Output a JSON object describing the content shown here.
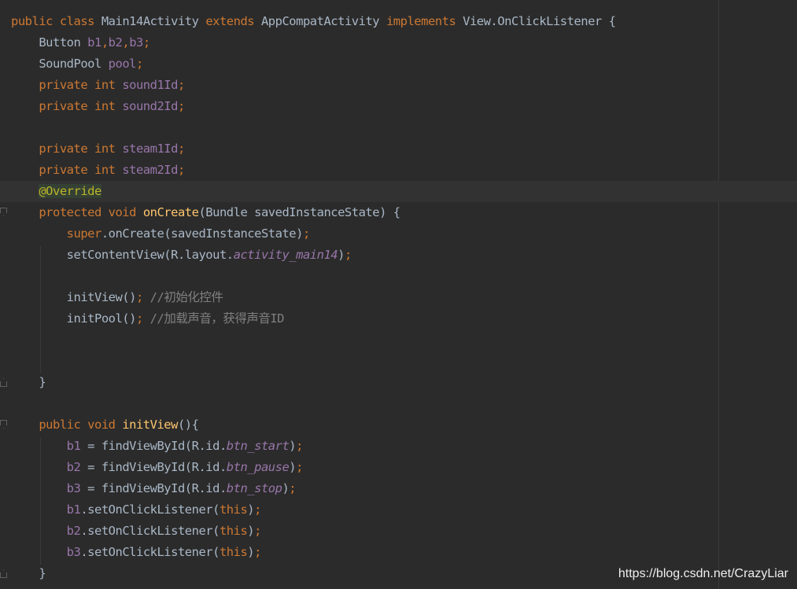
{
  "editor": {
    "highlighted_line": 9,
    "lines": [
      [
        [
          "keyword",
          "public class "
        ],
        [
          "plain",
          "Main14Activity "
        ],
        [
          "keyword",
          "extends "
        ],
        [
          "plain",
          "AppCompatActivity "
        ],
        [
          "keyword",
          "implements "
        ],
        [
          "plain",
          "View.OnClickListener {"
        ]
      ],
      [
        [
          "plain",
          "    Button "
        ],
        [
          "field",
          "b1"
        ],
        [
          "punct",
          ","
        ],
        [
          "field",
          "b2"
        ],
        [
          "punct",
          ","
        ],
        [
          "field",
          "b3"
        ],
        [
          "punct",
          ";"
        ]
      ],
      [
        [
          "plain",
          "    SoundPool "
        ],
        [
          "field",
          "pool"
        ],
        [
          "punct",
          ";"
        ]
      ],
      [
        [
          "keyword",
          "    private int "
        ],
        [
          "field",
          "sound1Id"
        ],
        [
          "punct",
          ";"
        ]
      ],
      [
        [
          "keyword",
          "    private int "
        ],
        [
          "field",
          "sound2Id"
        ],
        [
          "punct",
          ";"
        ]
      ],
      [],
      [
        [
          "keyword",
          "    private int "
        ],
        [
          "field",
          "steam1Id"
        ],
        [
          "punct",
          ";"
        ]
      ],
      [
        [
          "keyword",
          "    private int "
        ],
        [
          "field",
          "steam2Id"
        ],
        [
          "punct",
          ";"
        ]
      ],
      [
        [
          "plain",
          "    "
        ],
        [
          "anno",
          "@Override"
        ]
      ],
      [
        [
          "keyword",
          "    protected void "
        ],
        [
          "method",
          "onCreate"
        ],
        [
          "plain",
          "(Bundle savedInstanceState) {"
        ]
      ],
      [
        [
          "keyword",
          "        super"
        ],
        [
          "plain",
          ".onCreate(savedInstanceState)"
        ],
        [
          "punct",
          ";"
        ]
      ],
      [
        [
          "plain",
          "        setContentView(R.layout."
        ],
        [
          "static",
          "activity_main14"
        ],
        [
          "plain",
          ")"
        ],
        [
          "punct",
          ";"
        ]
      ],
      [],
      [
        [
          "plain",
          "        initView()"
        ],
        [
          "punct",
          "; "
        ],
        [
          "comment",
          "//初始化控件"
        ]
      ],
      [
        [
          "plain",
          "        initPool()"
        ],
        [
          "punct",
          "; "
        ],
        [
          "comment",
          "//加载声音，获得声音ID"
        ]
      ],
      [],
      [],
      [
        [
          "plain",
          "    }"
        ]
      ],
      [],
      [
        [
          "keyword",
          "    public void "
        ],
        [
          "method",
          "initView"
        ],
        [
          "plain",
          "(){"
        ]
      ],
      [
        [
          "plain",
          "        "
        ],
        [
          "field",
          "b1 "
        ],
        [
          "plain",
          "= findViewById(R.id."
        ],
        [
          "static",
          "btn_start"
        ],
        [
          "plain",
          ")"
        ],
        [
          "punct",
          ";"
        ]
      ],
      [
        [
          "plain",
          "        "
        ],
        [
          "field",
          "b2 "
        ],
        [
          "plain",
          "= findViewById(R.id."
        ],
        [
          "static",
          "btn_pause"
        ],
        [
          "plain",
          ")"
        ],
        [
          "punct",
          ";"
        ]
      ],
      [
        [
          "plain",
          "        "
        ],
        [
          "field",
          "b3 "
        ],
        [
          "plain",
          "= findViewById(R.id."
        ],
        [
          "static",
          "btn_stop"
        ],
        [
          "plain",
          ")"
        ],
        [
          "punct",
          ";"
        ]
      ],
      [
        [
          "plain",
          "        "
        ],
        [
          "field",
          "b1"
        ],
        [
          "plain",
          ".setOnClickListener("
        ],
        [
          "keyword",
          "this"
        ],
        [
          "plain",
          ")"
        ],
        [
          "punct",
          ";"
        ]
      ],
      [
        [
          "plain",
          "        "
        ],
        [
          "field",
          "b2"
        ],
        [
          "plain",
          ".setOnClickListener("
        ],
        [
          "keyword",
          "this"
        ],
        [
          "plain",
          ")"
        ],
        [
          "punct",
          ";"
        ]
      ],
      [
        [
          "plain",
          "        "
        ],
        [
          "field",
          "b3"
        ],
        [
          "plain",
          ".setOnClickListener("
        ],
        [
          "keyword",
          "this"
        ],
        [
          "plain",
          ")"
        ],
        [
          "punct",
          ";"
        ]
      ],
      [
        [
          "plain",
          "    }"
        ]
      ]
    ]
  },
  "watermark": {
    "text": "https://blog.csdn.net/CrazyLiar"
  },
  "colors": {
    "background": "#2b2b2b",
    "keyword": "#cc7832",
    "field": "#9876aa",
    "method": "#ffc66d",
    "annotation": "#bbb529",
    "comment": "#808080",
    "plain": "#a9b7c6"
  }
}
